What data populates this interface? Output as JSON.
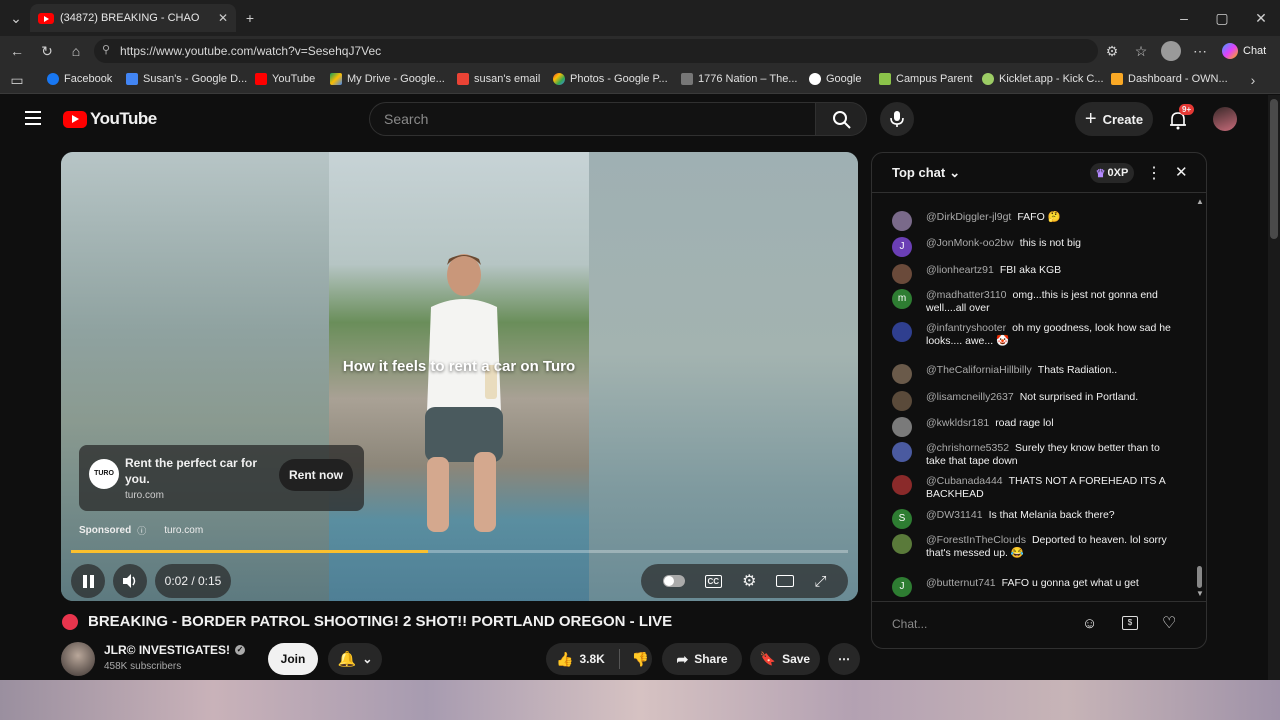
{
  "browser": {
    "tab_title": "(34872) BREAKING - CHAO",
    "url": "https://www.youtube.com/watch?v=SesehqJ7Vec",
    "chat_label": "Chat",
    "bookmarks": [
      "Facebook",
      "Susan's - Google D...",
      "YouTube",
      "My Drive - Google...",
      "susan's email",
      "Photos - Google P...",
      "1776 Nation – The...",
      "Google",
      "Campus Parent",
      "Kicklet.app - Kick C...",
      "Dashboard - OWN..."
    ]
  },
  "header": {
    "logo": "YouTube",
    "search_placeholder": "Search",
    "create_label": "Create",
    "notif_badge": "9+"
  },
  "player": {
    "overlay_text": "How it feels to rent a car on Turo",
    "ad_title": "Rent the perfect car for you.",
    "ad_domain": "turo.com",
    "ad_logo": "TURO",
    "rent_button": "Rent now",
    "sponsored": "Sponsored",
    "sponsor_domain": "turo.com",
    "time": "0:02 / 0:15",
    "progress": 0.46
  },
  "video": {
    "title": "BREAKING - BORDER PATROL SHOOTING! 2 SHOT!! PORTLAND OREGON - LIVE",
    "channel": "JLR© INVESTIGATES!",
    "subscribers": "458K subscribers",
    "join": "Join",
    "likes": "3.8K",
    "share": "Share",
    "save": "Save"
  },
  "chat": {
    "mode": "Top chat",
    "xp": "0XP",
    "input_placeholder": "Chat...",
    "messages": [
      {
        "author": "@DirkDiggler-jl9gt",
        "text": "FAFO 🤔",
        "color": "#7a6a8a",
        "initial": ""
      },
      {
        "author": "@JonMonk-oo2bw",
        "text": "this is not big",
        "color": "#6b3fb5",
        "initial": "J"
      },
      {
        "author": "@lionheartz91",
        "text": "FBI aka KGB",
        "color": "#6a4a3a",
        "initial": ""
      },
      {
        "author": "@madhatter3110",
        "text": "omg...this is jest not gonna end well....all over",
        "color": "#2e7d32",
        "initial": "m"
      },
      {
        "author": "@infantryshooter",
        "text": "oh my goodness, look how sad he looks.... awe... 🤡",
        "color": "#2f3f8f",
        "initial": ""
      },
      {
        "author": "@TheCaliforniaHillbilly",
        "text": "Thats Radiation..",
        "color": "#6a5a4a",
        "initial": ""
      },
      {
        "author": "@lisamcneilly2637",
        "text": "Not surprised in Portland.",
        "color": "#5a4a3a",
        "initial": ""
      },
      {
        "author": "@kwkldsr181",
        "text": "road rage lol",
        "color": "#7a7a7a",
        "initial": ""
      },
      {
        "author": "@chrishorne5352",
        "text": "Surely they know better than to take that tape down",
        "color": "#4a5aa0",
        "initial": ""
      },
      {
        "author": "@Cubanada444",
        "text": "THATS NOT A FOREHEAD ITS A BACKHEAD",
        "color": "#8a2a2a",
        "initial": ""
      },
      {
        "author": "@DW31141",
        "text": "Is that Melania back there?",
        "color": "#2e7d32",
        "initial": "S"
      },
      {
        "author": "@ForestInTheClouds",
        "text": "Deported to heaven. lol sorry that's messed up. 😂",
        "color": "#5a7a3a",
        "initial": ""
      },
      {
        "author": "@butternut741",
        "text": "FAFO u gonna get what u get",
        "color": "#2e7d32",
        "initial": "J"
      }
    ]
  }
}
